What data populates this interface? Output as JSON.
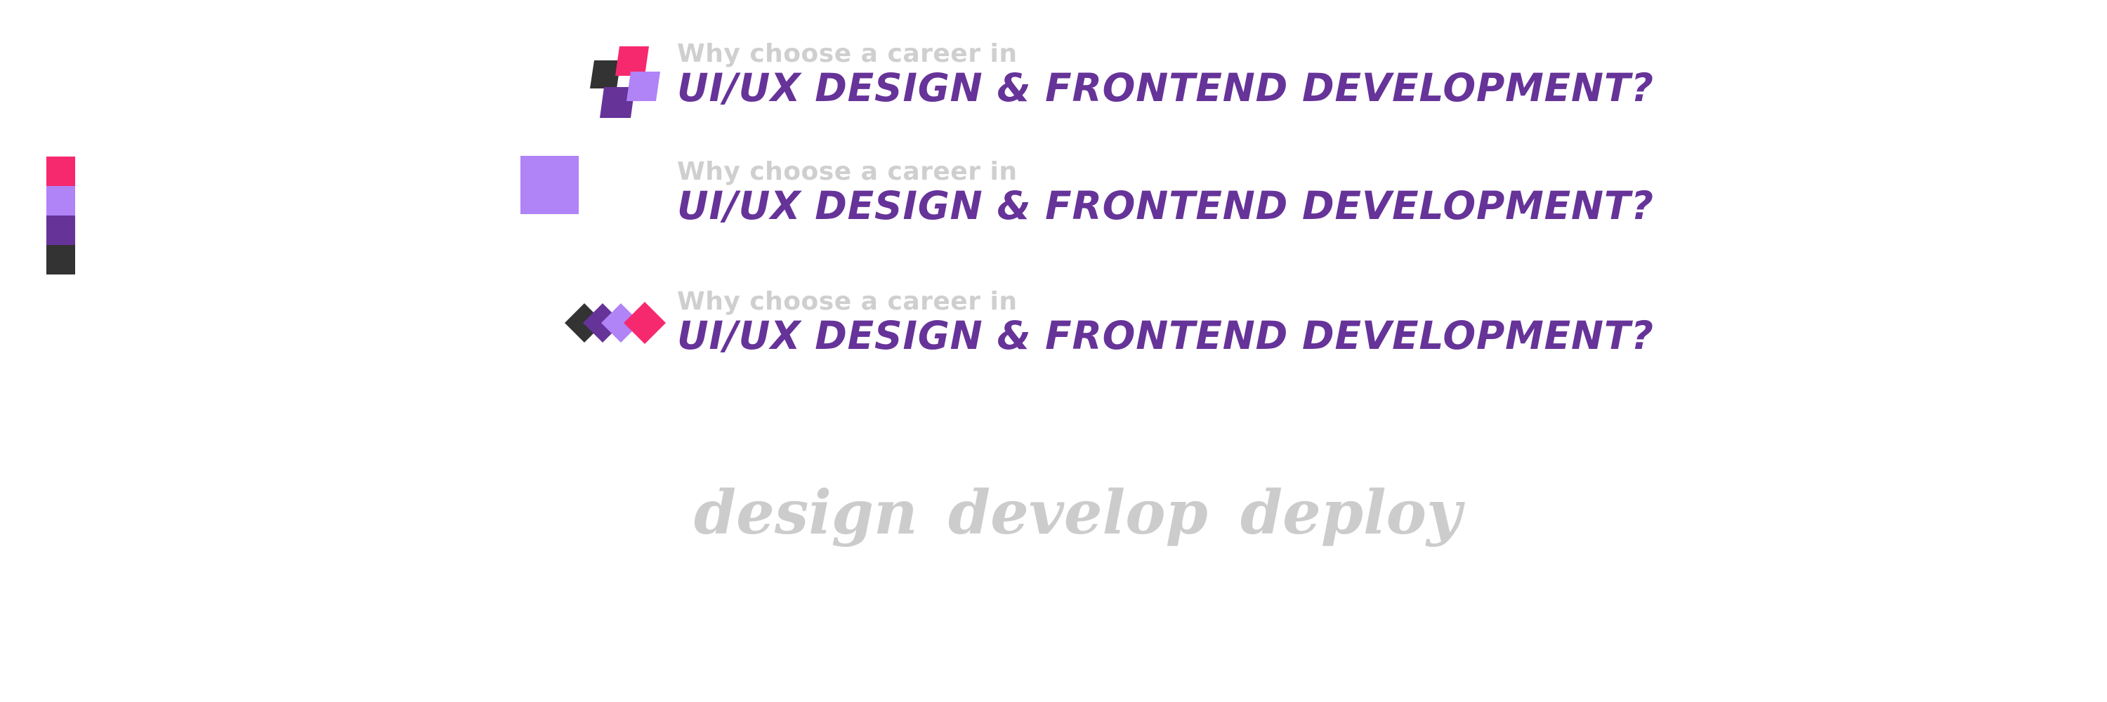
{
  "palette": {
    "colors": [
      "#f7296e",
      "#b083f7",
      "#663399",
      "#333333"
    ]
  },
  "banners": [
    {
      "logo": "pixel-blocks-logo",
      "subtitle": "Why choose a career in",
      "title": "UI/UX DESIGN & FRONTEND DEVELOPMENT?"
    },
    {
      "logo": "square-logo",
      "subtitle": "Why choose a career in",
      "title": "UI/UX DESIGN & FRONTEND DEVELOPMENT?"
    },
    {
      "logo": "diamond-row-logo",
      "subtitle": "Why choose a career in",
      "title": "UI/UX DESIGN & FRONTEND DEVELOPMENT?"
    }
  ],
  "taglines": [
    "design",
    "develop",
    "deploy"
  ],
  "colors": {
    "pink": "#f7296e",
    "lavender": "#b083f7",
    "purple": "#663399",
    "charcoal": "#333333",
    "muted_gray": "#cfcfcf"
  }
}
